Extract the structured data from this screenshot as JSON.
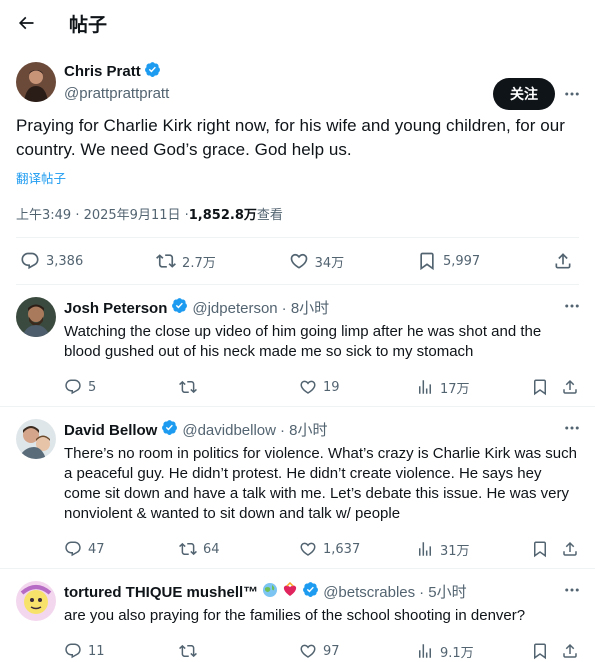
{
  "header": {
    "title": "帖子"
  },
  "post": {
    "author_name": "Chris Pratt",
    "handle": "@prattprattpratt",
    "follow_label": "关注",
    "text": "Praying for Charlie Kirk right now, for his wife and young children, for our country. We need God’s grace. God help us.",
    "translate_label": "翻译帖子",
    "time": "上午3:49 · 2025年9月11日 · ",
    "views_count": "1,852.8万",
    "views_label": " 查看",
    "stats": {
      "replies": "3,386",
      "reposts": "2.7万",
      "likes": "34万",
      "bookmarks": "5,997"
    }
  },
  "replies": [
    {
      "name": "Josh Peterson",
      "handle": "@jdpeterson",
      "time": "· 8小时",
      "text": "Watching the close up video of him going limp after he was shot and the blood gushed out of his neck made me so sick to my stomach",
      "stats": {
        "replies": "5",
        "reposts": "",
        "likes": "19",
        "views": "17万"
      }
    },
    {
      "name": "David Bellow",
      "handle": "@davidbellow",
      "time": "· 8小时",
      "text": "There’s no room in politics for violence. What’s crazy is Charlie Kirk was such a peaceful guy. He didn’t protest. He didn’t create violence. He says hey come sit down and have a talk with me. Let’s debate this issue. He was very nonviolent & wanted to sit down and talk w/ people",
      "stats": {
        "replies": "47",
        "reposts": "64",
        "likes": "1,637",
        "views": "31万"
      }
    },
    {
      "name": "tortured THIQUE mushell™",
      "handle": "@betscrables",
      "time": "· 5小时",
      "text": "are you also praying for the families of the school shooting in denver?",
      "stats": {
        "replies": "11",
        "reposts": "",
        "likes": "97",
        "views": "9.1万"
      }
    }
  ],
  "colors": {
    "accent": "#1d9bf0",
    "text": "#0f1419",
    "muted": "#536471"
  }
}
